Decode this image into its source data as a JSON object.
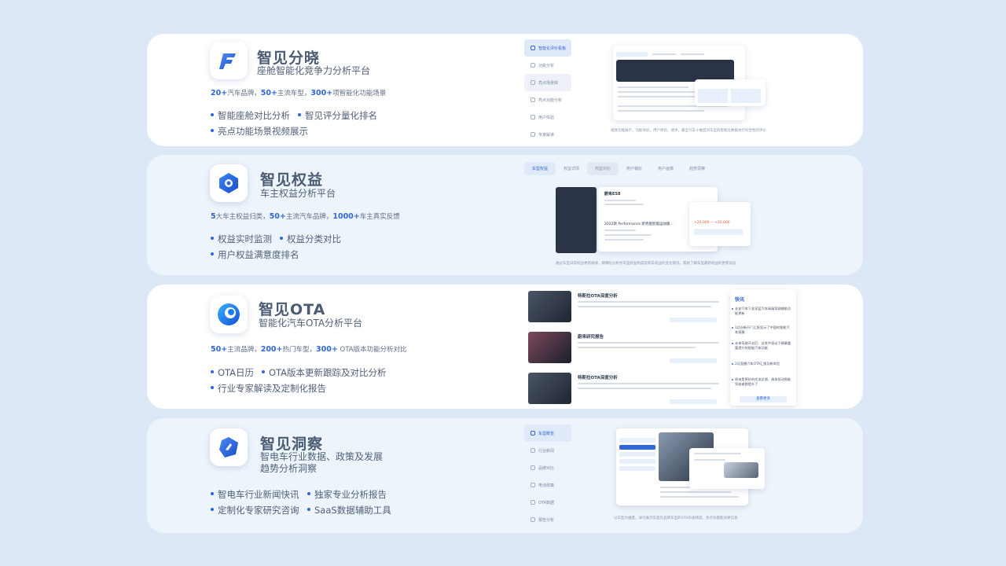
{
  "products": [
    {
      "name": "智见分晓",
      "subtitle": "座舱智能化竞争力分析平台",
      "stats": [
        {
          "num": "20+",
          "text": "汽车品牌，"
        },
        {
          "num": "50+",
          "text": "主流车型，"
        },
        {
          "num": "300+",
          "text": "项智能化功能场景"
        }
      ],
      "bullets": [
        "智能座舱对比分析",
        "智见评分量化排名",
        "亮点功能场景视频展示"
      ],
      "mock_nav": [
        "智能化评价看板",
        "功能分析",
        "亮点场景库",
        "亮点功能分析",
        "用户体验",
        "专家解读"
      ],
      "mock_caption": "视频功能展示，功能体验，用户体验，测评，最全汽车十维度对车型的智能化数据进行综合性的评价",
      "logo_color": "#2f67d8"
    },
    {
      "name": "智见权益",
      "subtitle": "车主权益分析平台",
      "stats": [
        {
          "num": "5",
          "text": "大车主权益归类，"
        },
        {
          "num": "50+",
          "text": "主流汽车品牌，"
        },
        {
          "num": "1000+",
          "text": "车主真实反馈"
        }
      ],
      "bullets": [
        "权益实时监测",
        "权益分类对比",
        "用户权益满意度排名"
      ],
      "mock_tabs": [
        "车型权益",
        "权益详情",
        "权益对比",
        "用户偏好",
        "用户画像",
        "趋势洞察"
      ],
      "mock_car": "蔚来ES8",
      "mock_banner": "2022款 Performance 新势能智能运动版…",
      "mock_price": "+20,000 ~ +20,000",
      "mock_caption": "通过车型日常权益更新规律，精细化分析各车型权益构成及购车权益的变化情况，帮助了解车型最新权益的更新动态",
      "logo_color": "#2f67d8"
    },
    {
      "name": "智见OTA",
      "subtitle": "智能化汽车OTA分析平台",
      "stats": [
        {
          "num": "50+",
          "text": "主流品牌，"
        },
        {
          "num": "200+",
          "text": "热门车型，"
        },
        {
          "num": "300+",
          "text": " OTA版本功能分析对比"
        }
      ],
      "bullets": [
        "OTA日历",
        "OTA版本更新跟踪及对比分析",
        "行业专家解读及定制化报告"
      ],
      "feed": [
        "特斯拉OTA深度分析",
        "蔚来研究报告",
        "特斯拉OTA深度分析"
      ],
      "news_title": "快讯",
      "news": [
        "长安汽车下发深蓝汽车高级驾驶辅助功能更新",
        "1月份新开门汇报显示了中国的智能汽车规模",
        "未来驾驶开启后：这其中驱动下辆最重要提升的智能汽车功能",
        "2月直播汽车OTA汇报及新车型",
        "原来是更好的交流反馈，具体驱动智能驾驶者都提升了"
      ],
      "news_button": "查看更多",
      "logo_color": "#1f7cf0"
    },
    {
      "name": "智见洞察",
      "subtitle": "智电车行业数据、政策及发展\n趋势分析洞察",
      "subtitle_l1": "智电车行业数据、政策及发展",
      "subtitle_l2": "趋势分析洞察",
      "bullets_left": [
        "智电车行业新闻快讯",
        "定制化专家研究咨询"
      ],
      "bullets_right": [
        "独家专业分析报告",
        "SaaS数据辅助工具"
      ],
      "mock_nav": [
        "车型概览",
        "行业新闻",
        "品牌对比",
        "电池政策",
        "OTA数据",
        "报告分析"
      ],
      "mock_caption": "以车型为维度，详尽展示车型在品牌车型的OTA升级频度，亮点功能能效果信息",
      "logo_color": "#2f67d8"
    }
  ],
  "colors": {
    "background": "#dce8f6",
    "accent": "#2f67d8",
    "card_white": "#ffffff",
    "card_tint": "#eef4fb"
  }
}
